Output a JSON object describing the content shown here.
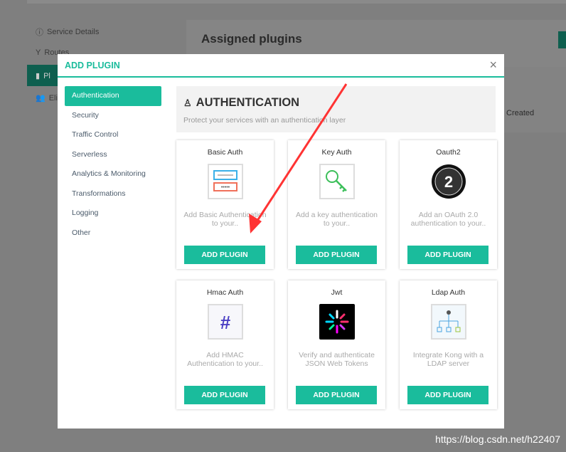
{
  "background": {
    "nav": [
      "Service Details",
      "Routes",
      "Pl",
      "Eli"
    ],
    "title": "Assigned plugins",
    "created": "Created"
  },
  "modal": {
    "title": "ADD PLUGIN",
    "close": "×",
    "nav": [
      "Authentication",
      "Security",
      "Traffic Control",
      "Serverless",
      "Analytics & Monitoring",
      "Transformations",
      "Logging",
      "Other"
    ],
    "section": {
      "title": "AUTHENTICATION",
      "subtitle": "Protect your services with an authentication layer"
    },
    "plugins": [
      {
        "name": "Basic Auth",
        "desc": "Add Basic Authentication to your..",
        "icon": "basic-auth-icon"
      },
      {
        "name": "Key Auth",
        "desc": "Add a key authentication to your..",
        "icon": "key-icon"
      },
      {
        "name": "Oauth2",
        "desc": "Add an OAuth 2.0 authentication to your..",
        "icon": "oauth2-icon"
      },
      {
        "name": "Hmac Auth",
        "desc": "Add HMAC Authentication to your..",
        "icon": "hash-icon"
      },
      {
        "name": "Jwt",
        "desc": "Verify and authenticate JSON Web Tokens",
        "icon": "jwt-icon"
      },
      {
        "name": "Ldap Auth",
        "desc": "Integrate Kong with a LDAP server",
        "icon": "ldap-icon"
      }
    ],
    "button_label": "ADD PLUGIN"
  },
  "watermark": "https://blog.csdn.net/h22407",
  "colors": {
    "accent": "#1abc9c",
    "arrow": "#ff3333"
  }
}
